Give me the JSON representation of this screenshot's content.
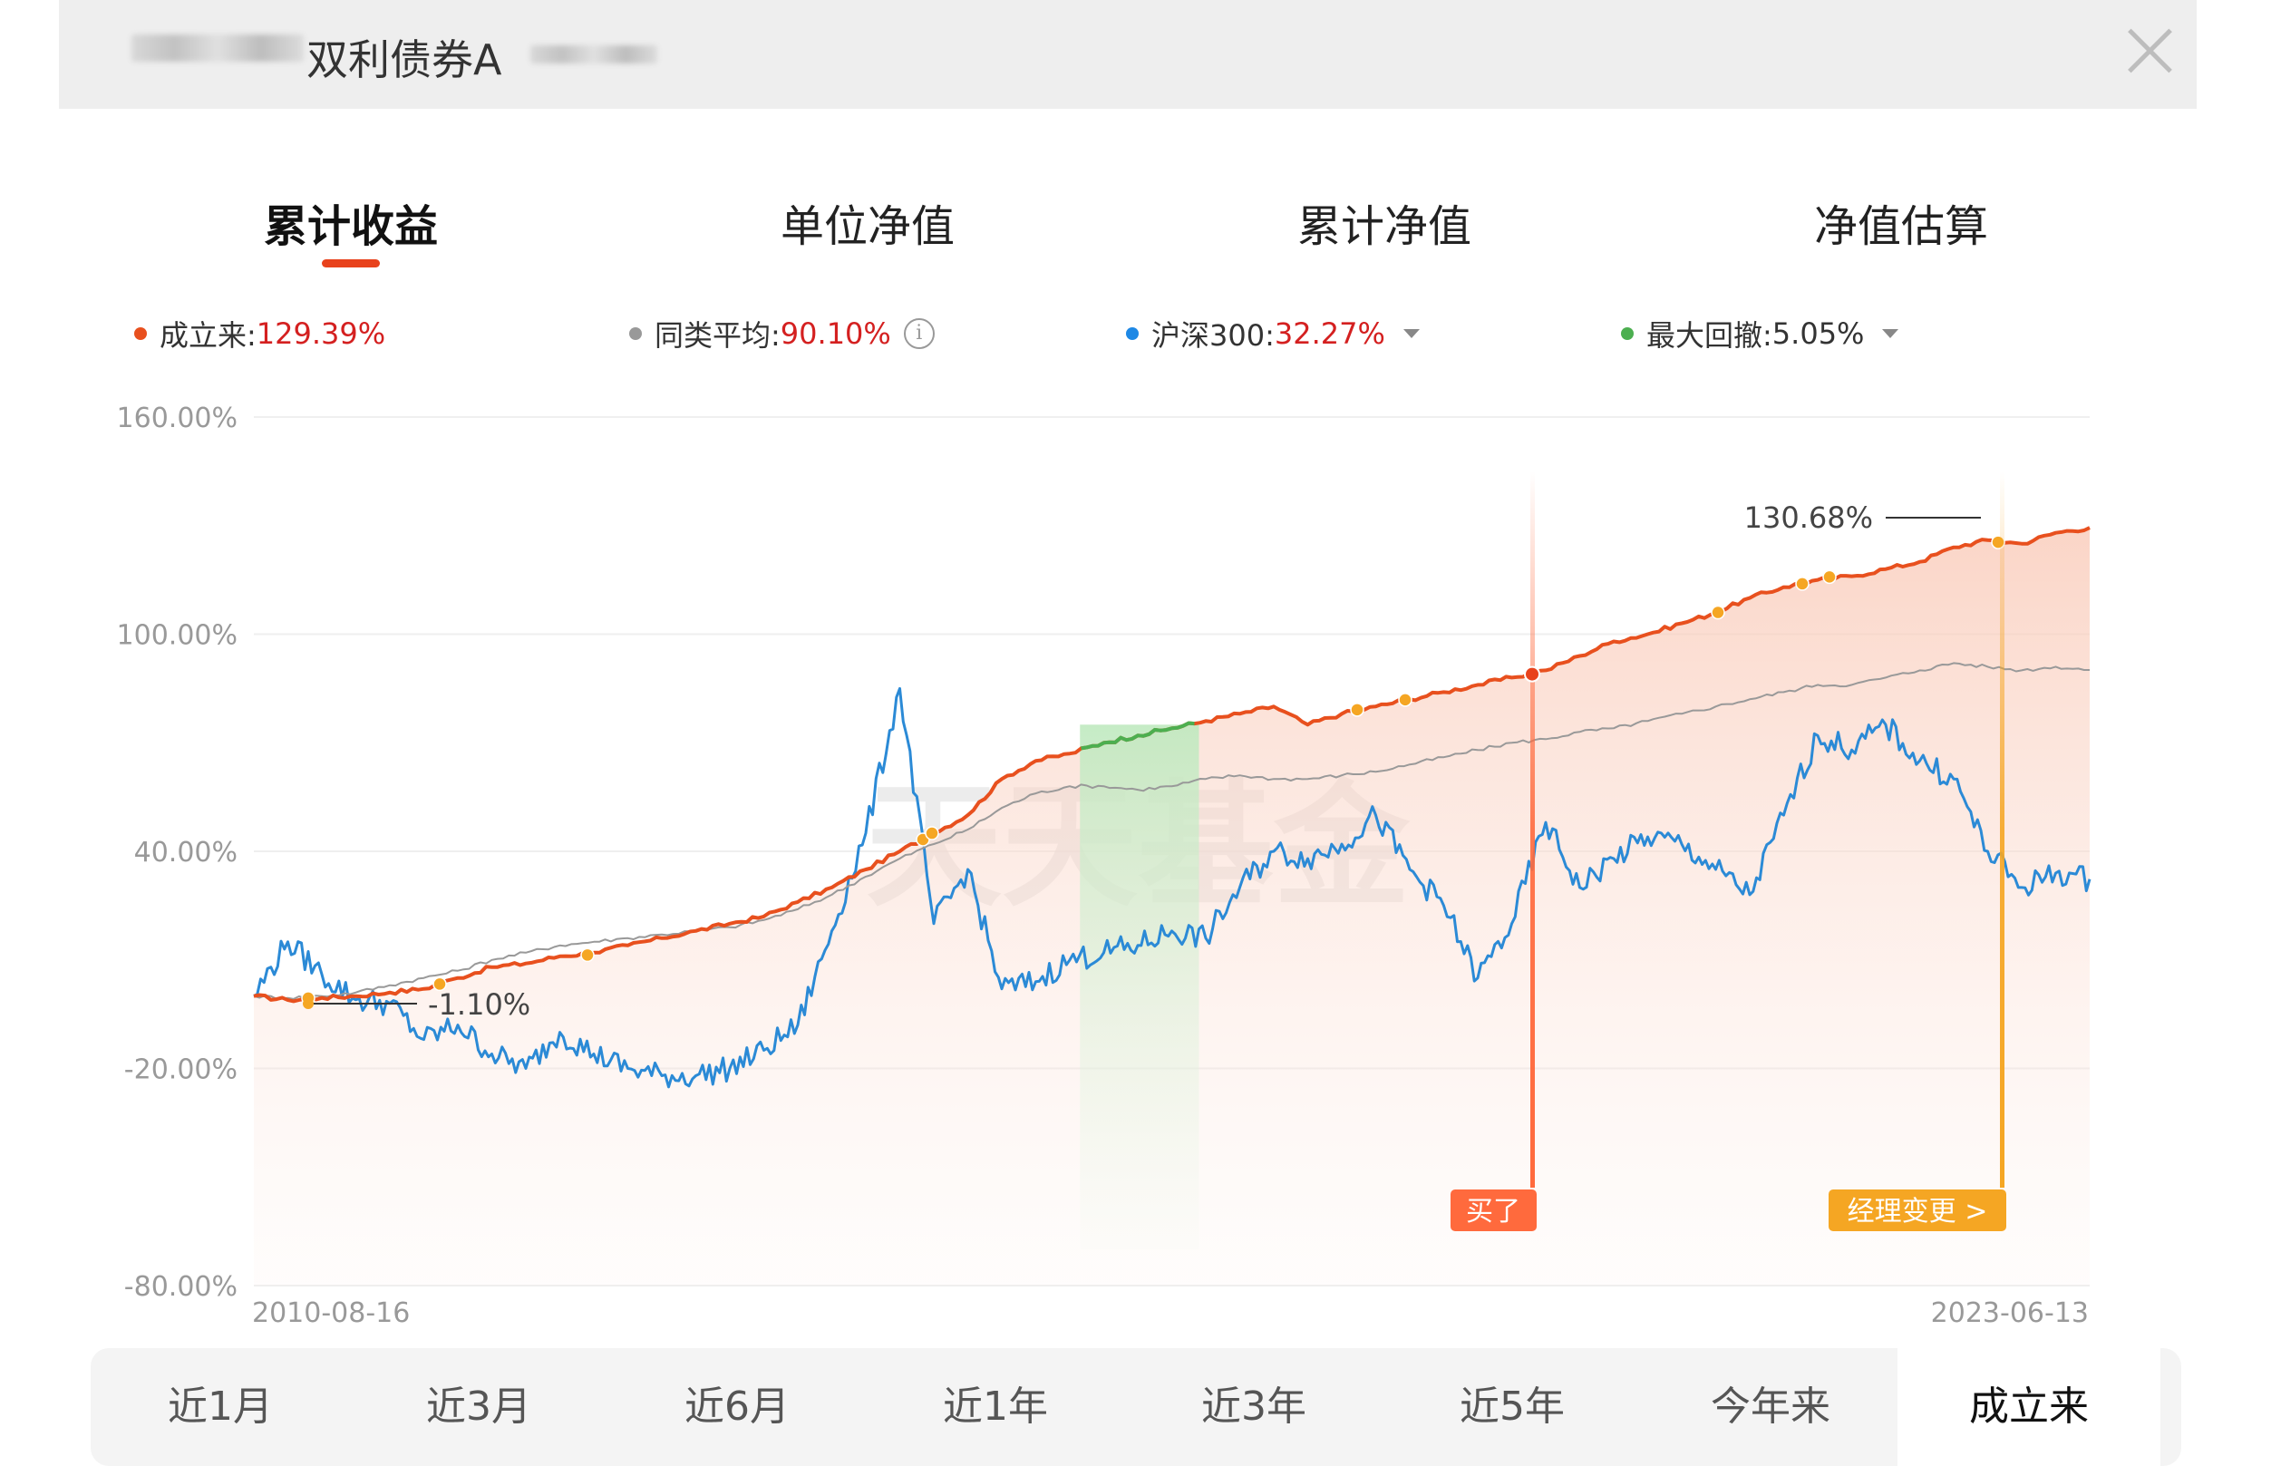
{
  "header": {
    "title": "双利债券A"
  },
  "tabs": [
    {
      "label": "累计收益",
      "active": true
    },
    {
      "label": "单位净值",
      "active": false
    },
    {
      "label": "累计净值",
      "active": false
    },
    {
      "label": "净值估算",
      "active": false
    }
  ],
  "legend": [
    {
      "label": "成立来:",
      "value": "129.39%",
      "color": "#e8501e"
    },
    {
      "label": "同类平均:",
      "value": "90.10%",
      "color": "#999999"
    },
    {
      "label": "沪深300:",
      "value": "32.27%",
      "color": "#1e88e5"
    },
    {
      "label": "最大回撤:",
      "value": "5.05%",
      "color": "#4caf50"
    }
  ],
  "chart_data": {
    "type": "line",
    "x_start": "2010-08-16",
    "x_end": "2023-06-13",
    "ylim": [
      -80,
      160
    ],
    "yticks": [
      "160.00%",
      "100.00%",
      "40.00%",
      "-20.00%",
      "-80.00%"
    ],
    "watermark": "天天基金",
    "series": [
      {
        "name": "成立来",
        "color": "#e8501e",
        "values": [
          0,
          -1.1,
          -0.5,
          0,
          1,
          2,
          5,
          8,
          9,
          11,
          12,
          14,
          16,
          18,
          20,
          22,
          26,
          30,
          35,
          40,
          45,
          50,
          60,
          65,
          67,
          70,
          72,
          74,
          76,
          78,
          80,
          75,
          78,
          80,
          82,
          84,
          86,
          88,
          90,
          94,
          98,
          100,
          103,
          106,
          110,
          113,
          115,
          116,
          118,
          120,
          124,
          126,
          125,
          128,
          129.4
        ]
      },
      {
        "name": "同类平均",
        "color": "#999999",
        "values": [
          0,
          -0.5,
          0,
          1,
          3,
          5,
          7,
          10,
          12,
          14,
          15,
          16,
          17,
          18,
          19,
          21,
          24,
          28,
          33,
          38,
          42,
          46,
          52,
          56,
          58,
          58,
          57,
          58,
          60,
          61,
          60,
          60,
          61,
          62,
          64,
          66,
          68,
          70,
          71,
          73,
          74,
          76,
          78,
          80,
          82,
          84,
          86,
          86,
          88,
          90,
          92,
          91,
          90,
          91,
          90.1
        ]
      },
      {
        "name": "沪深300",
        "color": "#2b8ad6",
        "values": [
          0,
          15,
          6,
          -1,
          -2,
          -12,
          -8,
          -16,
          -20,
          -10,
          -16,
          -20,
          -22,
          -22,
          -20,
          -15,
          -8,
          18,
          45,
          85,
          20,
          35,
          2,
          4,
          10,
          12,
          14,
          18,
          16,
          30,
          40,
          38,
          42,
          50,
          35,
          25,
          5,
          20,
          48,
          30,
          38,
          44,
          42,
          35,
          28,
          50,
          72,
          68,
          75,
          65,
          60,
          40,
          30,
          34,
          32.3
        ]
      }
    ],
    "annotations": {
      "max_label": "130.68%",
      "min_label": "-1.10%",
      "buy_label": "买了",
      "manager_label": "经理变更 >"
    }
  },
  "periods": [
    {
      "label": "近1月",
      "active": false
    },
    {
      "label": "近3月",
      "active": false
    },
    {
      "label": "近6月",
      "active": false
    },
    {
      "label": "近1年",
      "active": false
    },
    {
      "label": "近3年",
      "active": false
    },
    {
      "label": "近5年",
      "active": false
    },
    {
      "label": "今年来",
      "active": false
    },
    {
      "label": "成立来",
      "active": true
    }
  ]
}
